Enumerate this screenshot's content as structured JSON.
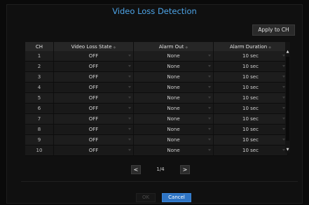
{
  "title": "Video Loss Detection",
  "apply_to_ch": "Apply to CH",
  "columns": {
    "ch": "CH",
    "state": "Video Loss State",
    "alarm_out": "Alarm Out",
    "duration": "Alarm Duration"
  },
  "rows": [
    {
      "ch": "1",
      "state": "OFF",
      "alarm_out": "None",
      "duration": "10 sec"
    },
    {
      "ch": "2",
      "state": "OFF",
      "alarm_out": "None",
      "duration": "10 sec"
    },
    {
      "ch": "3",
      "state": "OFF",
      "alarm_out": "None",
      "duration": "10 sec"
    },
    {
      "ch": "4",
      "state": "OFF",
      "alarm_out": "None",
      "duration": "10 sec"
    },
    {
      "ch": "5",
      "state": "OFF",
      "alarm_out": "None",
      "duration": "10 sec"
    },
    {
      "ch": "6",
      "state": "OFF",
      "alarm_out": "None",
      "duration": "10 sec"
    },
    {
      "ch": "7",
      "state": "OFF",
      "alarm_out": "None",
      "duration": "10 sec"
    },
    {
      "ch": "8",
      "state": "OFF",
      "alarm_out": "None",
      "duration": "10 sec"
    },
    {
      "ch": "9",
      "state": "OFF",
      "alarm_out": "None",
      "duration": "10 sec"
    },
    {
      "ch": "10",
      "state": "OFF",
      "alarm_out": "None",
      "duration": "10 sec"
    }
  ],
  "pager": {
    "prev": "<",
    "next": ">",
    "page": "1/4"
  },
  "buttons": {
    "ok": "OK",
    "cancel": "Cancel"
  },
  "colors": {
    "title": "#4da3e6",
    "cancel_bg": "#2e74c4"
  }
}
